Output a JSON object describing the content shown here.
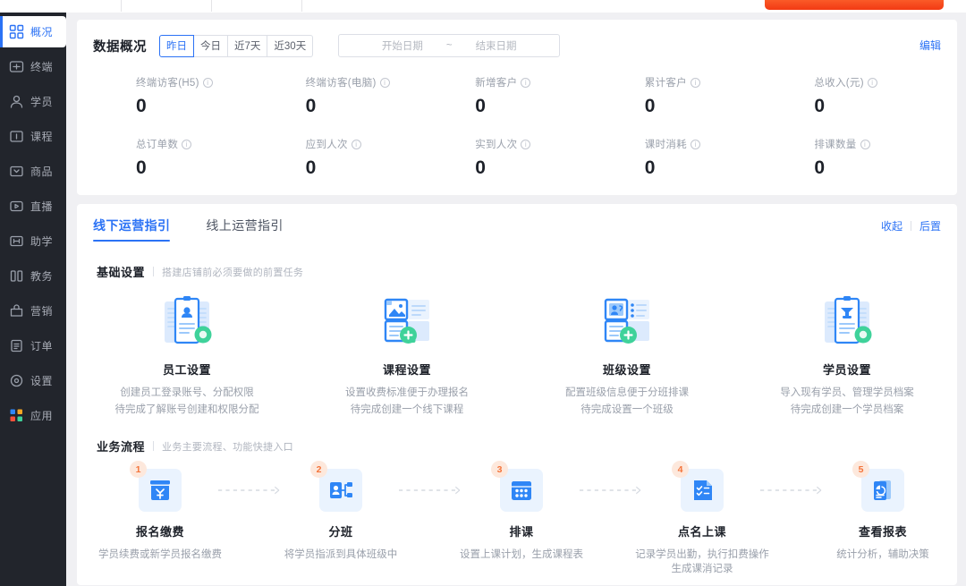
{
  "sidebar": {
    "items": [
      {
        "label": "概况",
        "icon": "grid-icon",
        "active": true
      },
      {
        "label": "终端",
        "icon": "terminal-icon",
        "active": false
      },
      {
        "label": "学员",
        "icon": "student-icon",
        "active": false
      },
      {
        "label": "课程",
        "icon": "course-icon",
        "active": false
      },
      {
        "label": "商品",
        "icon": "goods-icon",
        "active": false
      },
      {
        "label": "直播",
        "icon": "live-icon",
        "active": false
      },
      {
        "label": "助学",
        "icon": "assist-icon",
        "active": false
      },
      {
        "label": "教务",
        "icon": "academic-icon",
        "active": false
      },
      {
        "label": "营销",
        "icon": "marketing-icon",
        "active": false
      },
      {
        "label": "订单",
        "icon": "order-icon",
        "active": false
      },
      {
        "label": "设置",
        "icon": "settings-icon",
        "active": false
      },
      {
        "label": "应用",
        "icon": "apps-icon",
        "active": false
      }
    ]
  },
  "overview": {
    "title": "数据概况",
    "edit_label": "编辑",
    "range_buttons": [
      {
        "label": "昨日",
        "selected": true
      },
      {
        "label": "今日",
        "selected": false
      },
      {
        "label": "近7天",
        "selected": false
      },
      {
        "label": "近30天",
        "selected": false
      }
    ],
    "date_start_placeholder": "开始日期",
    "date_separator": "~",
    "date_end_placeholder": "结束日期",
    "stats_row1": [
      {
        "label": "终端访客(H5)",
        "value": "0"
      },
      {
        "label": "终端访客(电脑)",
        "value": "0"
      },
      {
        "label": "新增客户",
        "value": "0"
      },
      {
        "label": "累计客户",
        "value": "0"
      },
      {
        "label": "总收入(元)",
        "value": "0"
      }
    ],
    "stats_row2": [
      {
        "label": "总订单数",
        "value": "0"
      },
      {
        "label": "应到人次",
        "value": "0"
      },
      {
        "label": "实到人次",
        "value": "0"
      },
      {
        "label": "课时消耗",
        "value": "0"
      },
      {
        "label": "排课数量",
        "value": "0"
      }
    ]
  },
  "guide": {
    "tabs": [
      {
        "label": "线下运营指引",
        "active": true
      },
      {
        "label": "线上运营指引",
        "active": false
      }
    ],
    "collapse_label": "收起",
    "postpone_label": "后置",
    "basic": {
      "title": "基础设置",
      "subtitle": "搭建店铺前必须要做的前置任务",
      "cards": [
        {
          "name": "员工设置",
          "desc": "创建员工登录账号、分配权限",
          "desc2": "待完成了解账号创建和权限分配",
          "icon": "clipboard-person-icon",
          "badge": "check"
        },
        {
          "name": "课程设置",
          "desc": "设置收费标准便于办理报名",
          "desc2": "待完成创建一个线下课程",
          "icon": "course-layout-icon",
          "badge": "plus"
        },
        {
          "name": "班级设置",
          "desc": "配置班级信息便于分班排课",
          "desc2": "待完成设置一个班级",
          "icon": "class-layout-icon",
          "badge": "plus"
        },
        {
          "name": "学员设置",
          "desc": "导入现有学员、管理学员档案",
          "desc2": "待完成创建一个学员档案",
          "icon": "clipboard-student-icon",
          "badge": "check"
        }
      ]
    },
    "process": {
      "title": "业务流程",
      "subtitle": "业务主要流程、功能快捷入口",
      "steps": [
        {
          "num": "1",
          "name": "报名缴费",
          "desc": "学员续费或新学员报名缴费",
          "desc2": "",
          "icon": "payment-icon"
        },
        {
          "num": "2",
          "name": "分班",
          "desc": "将学员指派到具体班级中",
          "desc2": "",
          "icon": "assign-class-icon"
        },
        {
          "num": "3",
          "name": "排课",
          "desc": "设置上课计划，生成课程表",
          "desc2": "",
          "icon": "schedule-icon"
        },
        {
          "num": "4",
          "name": "点名上课",
          "desc": "记录学员出勤，执行扣费操作",
          "desc2": "生成课消记录",
          "icon": "attendance-icon"
        },
        {
          "num": "5",
          "name": "查看报表",
          "desc": "统计分析，辅助决策",
          "desc2": "",
          "icon": "report-icon"
        }
      ]
    }
  },
  "colors": {
    "accent": "#2b72f5",
    "sidebar_bg": "#22252c",
    "page_bg": "#f0f0f3",
    "badge_orange": "#f4743b",
    "badge_green": "#3fd29a",
    "icon_blue": "#2f86f6",
    "top_button": "#f23a13"
  }
}
